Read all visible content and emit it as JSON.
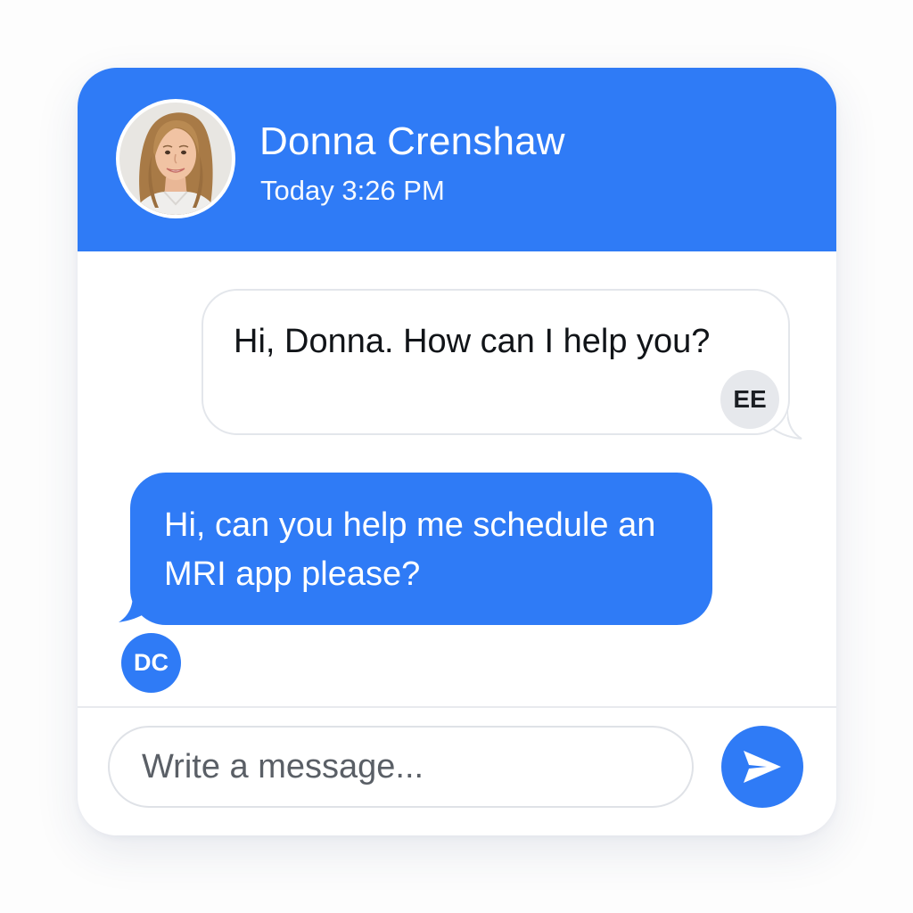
{
  "contact": {
    "name": "Donna Crenshaw",
    "time": "Today 3:26 PM",
    "avatar": "woman-portrait-photo"
  },
  "messages": [
    {
      "direction": "incoming",
      "text": "Hi, Donna. How can I help you?",
      "sender_initials": "EE"
    },
    {
      "direction": "outgoing",
      "text": "Hi, can you help me schedule an MRI app please?",
      "sender_initials": "DC"
    }
  ],
  "composer": {
    "placeholder": "Write a message...",
    "value": ""
  },
  "icons": {
    "send": "send-icon"
  },
  "colors": {
    "accent": "#2f7bf6",
    "bubble_border": "#e3e6eb",
    "badge_gray": "#e6e8ec"
  }
}
